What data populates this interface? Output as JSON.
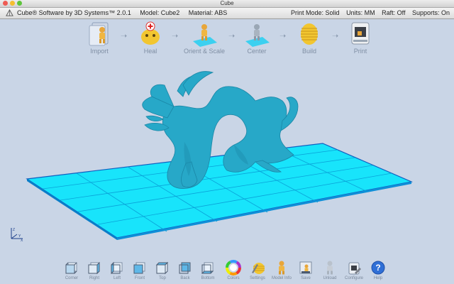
{
  "window": {
    "title": "Cube"
  },
  "infobar": {
    "app_name": "Cube® Software by 3D Systems™ 2.0.1",
    "model": "Model: Cube2",
    "material": "Material: ABS",
    "print_mode": "Print Mode: Solid",
    "units": "Units: MM",
    "raft": "Raft: Off",
    "supports": "Supports: On"
  },
  "workflow": {
    "steps": [
      {
        "label": "Import",
        "icon": "folder-figure-icon"
      },
      {
        "label": "Heal",
        "icon": "heal-figure-icon"
      },
      {
        "label": "Orient & Scale",
        "icon": "orient-figure-icon"
      },
      {
        "label": "Center",
        "icon": "center-figure-icon"
      },
      {
        "label": "Build",
        "icon": "build-layers-icon"
      },
      {
        "label": "Print",
        "icon": "printer-icon"
      }
    ]
  },
  "toolbar": {
    "buttons": [
      {
        "label": "Corner",
        "icon": "view-corner-icon"
      },
      {
        "label": "Right",
        "icon": "view-right-icon"
      },
      {
        "label": "Left",
        "icon": "view-left-icon"
      },
      {
        "label": "Front",
        "icon": "view-front-icon"
      },
      {
        "label": "Top",
        "icon": "view-top-icon"
      },
      {
        "label": "Back",
        "icon": "view-back-icon"
      },
      {
        "label": "Bottom",
        "icon": "view-bottom-icon"
      },
      {
        "label": "Colors",
        "icon": "color-wheel-icon"
      },
      {
        "label": "Settings",
        "icon": "settings-icon"
      },
      {
        "label": "Model Info",
        "icon": "model-info-icon"
      },
      {
        "label": "Save",
        "icon": "save-icon"
      },
      {
        "label": "Unload",
        "icon": "unload-icon"
      },
      {
        "label": "Configure",
        "icon": "configure-icon"
      },
      {
        "label": "Help",
        "icon": "help-icon"
      }
    ]
  },
  "colors": {
    "bed": "#18e4fb",
    "bed_edge": "#1060c0",
    "model": "#27a8c8",
    "accent_gold": "#f2c630"
  }
}
